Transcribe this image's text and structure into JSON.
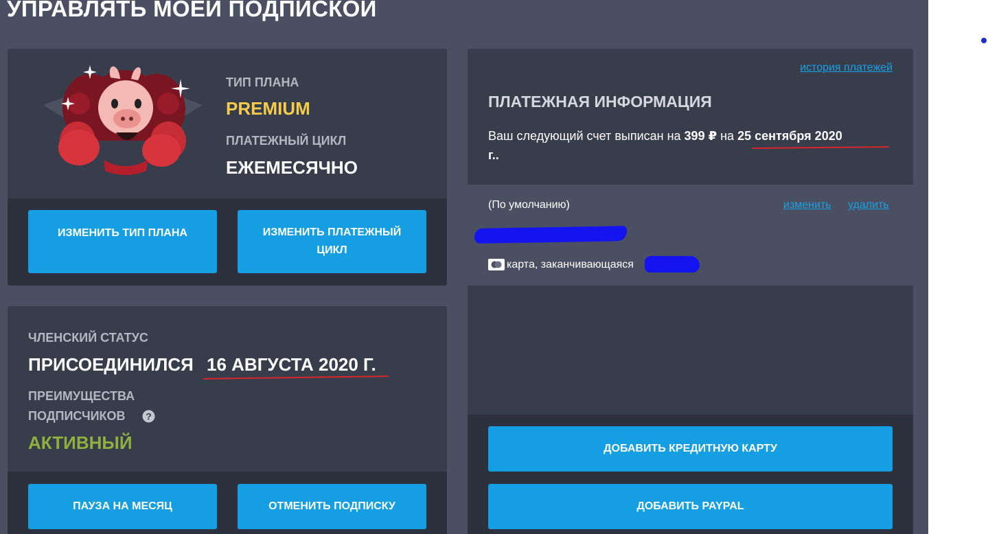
{
  "modal": {
    "title": "УПРАВЛЯТЬ МОЕЙ ПОДПИСКОЙ"
  },
  "plan": {
    "type_label": "ТИП ПЛАНА",
    "type_value": "PREMIUM",
    "cycle_label": "ПЛАТЕЖНЫЙ ЦИКЛ",
    "cycle_value": "ЕЖЕМЕСЯЧНО",
    "change_plan_button": "ИЗМЕНИТЬ ТИП ПЛАНА",
    "change_cycle_button": "ИЗМЕНИТЬ ПЛАТЕЖНЫЙ ЦИКЛ"
  },
  "membership": {
    "status_label": "ЧЛЕНСКИЙ СТАТУС",
    "joined_prefix": "ПРИСОЕДИНИЛСЯ",
    "joined_date": "16 АВГУСТА 2020 Г.",
    "benefits_label_line1": "ПРЕИМУЩЕСТВА",
    "benefits_label_line2": "ПОДПИСЧИКОВ",
    "benefits_value": "АКТИВНЫЙ",
    "pause_button": "ПАУЗА НА МЕСЯЦ",
    "cancel_button": "ОТМЕНИТЬ ПОДПИСКУ"
  },
  "payment": {
    "history_link": "история платежей",
    "title": "ПЛАТЕЖНАЯ ИНФОРМАЦИЯ",
    "next_bill_prefix": "Ваш следующий счет выписан на ",
    "amount": "399 ₽",
    "on_word": " на ",
    "bill_date": "25 сентября 2020",
    "bill_suffix": "г..",
    "default_label": "(По умолчанию)",
    "edit_link": "изменить",
    "delete_link": "удалить",
    "card_text": "карта, заканчивающаяся",
    "add_card_button": "ДОБАВИТЬ КРЕДИТНУЮ КАРТУ",
    "add_paypal_button": "ДОБАВИТЬ PAYPAL"
  },
  "colors": {
    "modal_bg": "#4a5061",
    "panel_bg": "#383d4c",
    "footer_bg": "#2d313d",
    "accent_blue": "#159ee2",
    "premium_yellow": "#f6cc4a",
    "active_green": "#8fb03e",
    "annotation_red": "#d8242c"
  },
  "icons": [
    "close-icon",
    "help-icon",
    "card-icon",
    "premium-pig-mascot"
  ]
}
